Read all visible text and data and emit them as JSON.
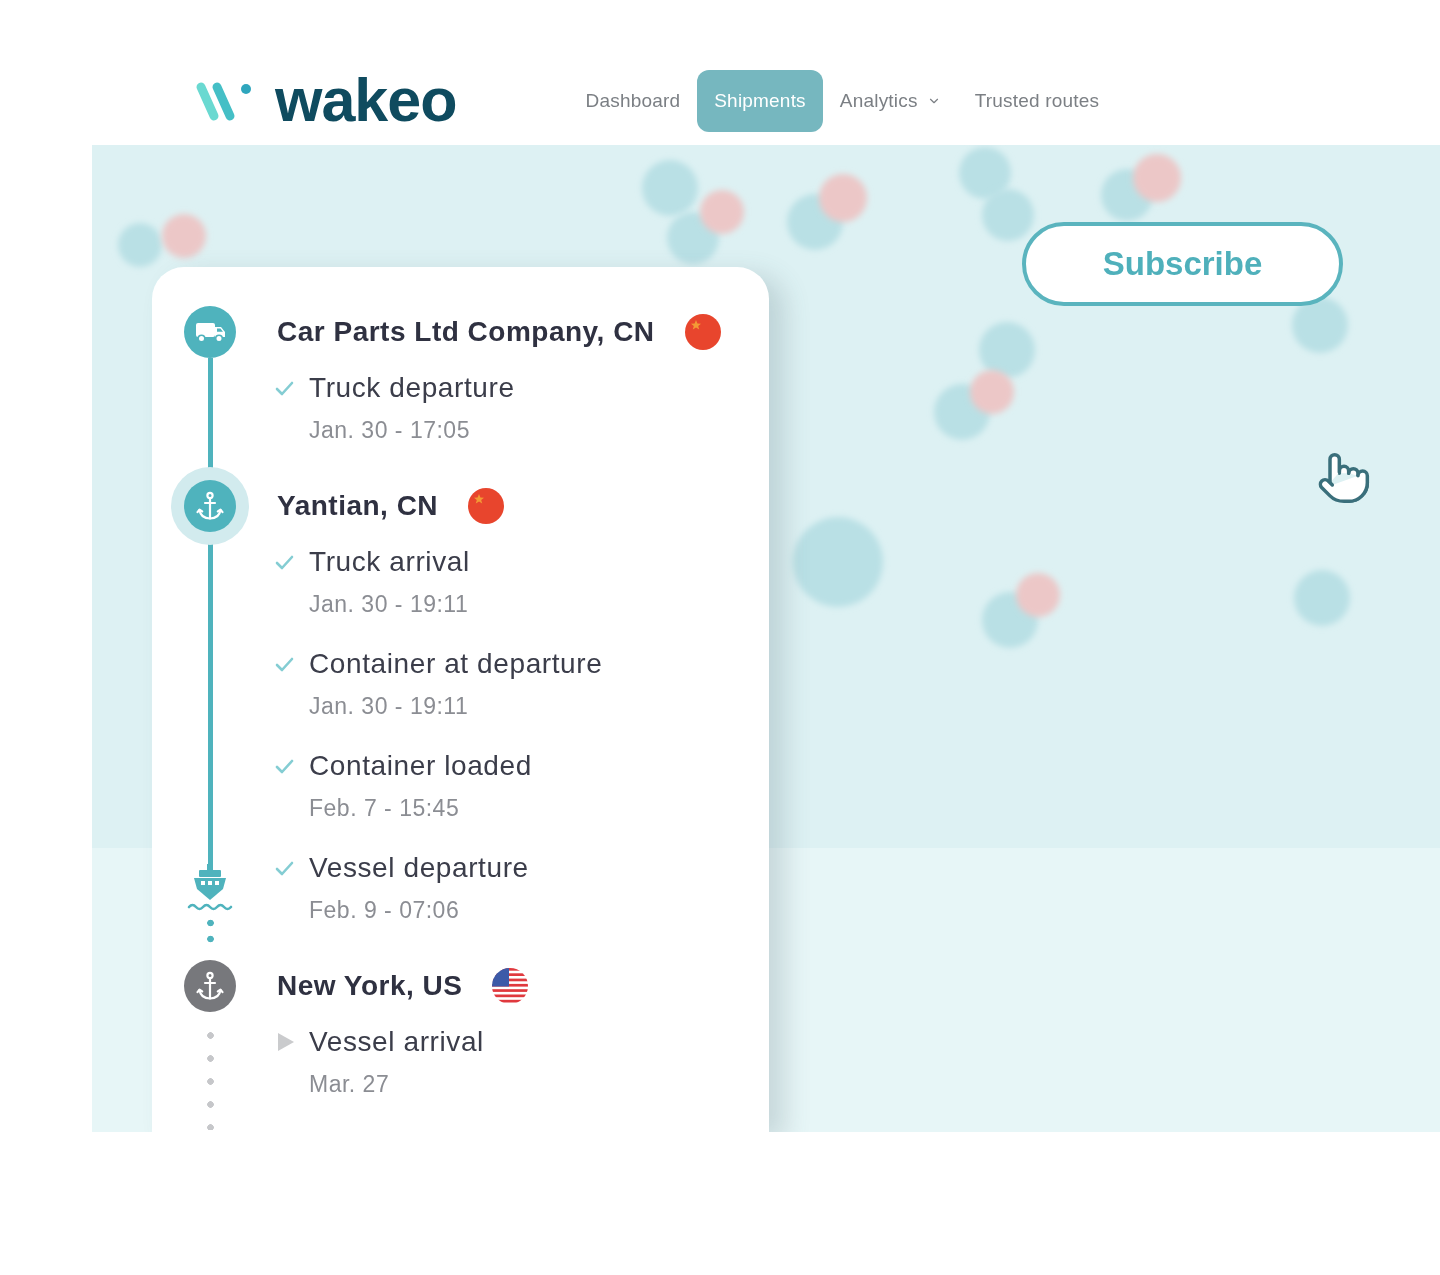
{
  "header": {
    "logo": {
      "text": "wakeo"
    },
    "nav": [
      {
        "label": "Dashboard",
        "selected": false,
        "dropdown": false
      },
      {
        "label": "Shipments",
        "selected": true,
        "dropdown": false
      },
      {
        "label": "Analytics",
        "selected": false,
        "dropdown": true
      },
      {
        "label": "Trusted routes",
        "selected": false,
        "dropdown": false
      }
    ]
  },
  "hero": {
    "subscribe_button": {
      "label": "Subscribe"
    }
  },
  "timeline": {
    "stops": [
      {
        "name": "Car Parts Ltd Company, CN",
        "flag": {
          "kind": "cn"
        },
        "node": {
          "kind": "truck"
        },
        "reached": true,
        "current": false,
        "leg": {
          "kind": "solid"
        },
        "events": [
          {
            "label": "Truck departure",
            "date": "Jan. 30 - 17:05",
            "done": true
          }
        ]
      },
      {
        "name": "Yantian, CN",
        "flag": {
          "kind": "cn"
        },
        "node": {
          "kind": "anchor"
        },
        "reached": true,
        "current": true,
        "leg": {
          "kind": "vessel"
        },
        "events": [
          {
            "label": "Truck arrival",
            "date": "Jan. 30 - 19:11",
            "done": true
          },
          {
            "label": "Container at departure",
            "date": "Jan. 30 - 19:11",
            "done": true
          },
          {
            "label": "Container loaded",
            "date": "Feb. 7 - 15:45",
            "done": true
          },
          {
            "label": "Vessel departure",
            "date": "Feb. 9 - 07:06",
            "done": true
          }
        ]
      },
      {
        "name": "New York, US",
        "flag": {
          "kind": "us"
        },
        "node": {
          "kind": "anchor"
        },
        "reached": false,
        "current": false,
        "leg": {
          "kind": "dotted"
        },
        "events": [
          {
            "label": "Vessel arrival",
            "date": "Mar. 27",
            "done": false
          }
        ]
      }
    ]
  }
}
